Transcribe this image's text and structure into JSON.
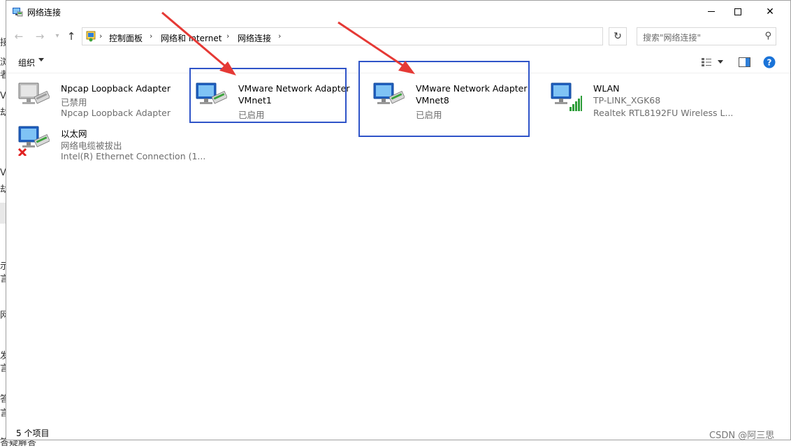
{
  "window": {
    "title": "网络连接"
  },
  "background_fragments": [
    "接",
    "浏",
    "者",
    "VL",
    "劫",
    "VL",
    "劫",
    "示",
    "言",
    "网",
    "发",
    "言",
    "答",
    "言",
    "答疑解答"
  ],
  "nav": {
    "breadcrumbs": [
      "控制面板",
      "网络和 Internet",
      "网络连接"
    ],
    "search_placeholder": "搜索\"网络连接\""
  },
  "toolbar": {
    "organize_label": "组织"
  },
  "items": [
    {
      "name": "Npcap Loopback Adapter",
      "line2": "已禁用",
      "line3": "Npcap Loopback Adapter",
      "status": "disabled"
    },
    {
      "name": "VMware Network Adapter",
      "line2": "VMnet1",
      "line3": "已启用",
      "status": "enabled"
    },
    {
      "name": "VMware Network Adapter",
      "line2": "VMnet8",
      "line3": "已启用",
      "status": "enabled"
    },
    {
      "name": "WLAN",
      "line2": "TP-LINK_XGK68",
      "line3": "Realtek RTL8192FU Wireless L...",
      "status": "wireless"
    },
    {
      "name": "以太网",
      "line2": "网络电缆被拔出",
      "line3": "Intel(R) Ethernet Connection (1...",
      "status": "unplugged"
    }
  ],
  "status": {
    "item_count": "5 个项目"
  },
  "watermark": "CSDN @阿三思",
  "colors": {
    "highlight_box": "#2f54c8",
    "annotation_arrow": "#e53935",
    "help_blue": "#1a73d8",
    "signal_green": "#2e9e3a"
  }
}
